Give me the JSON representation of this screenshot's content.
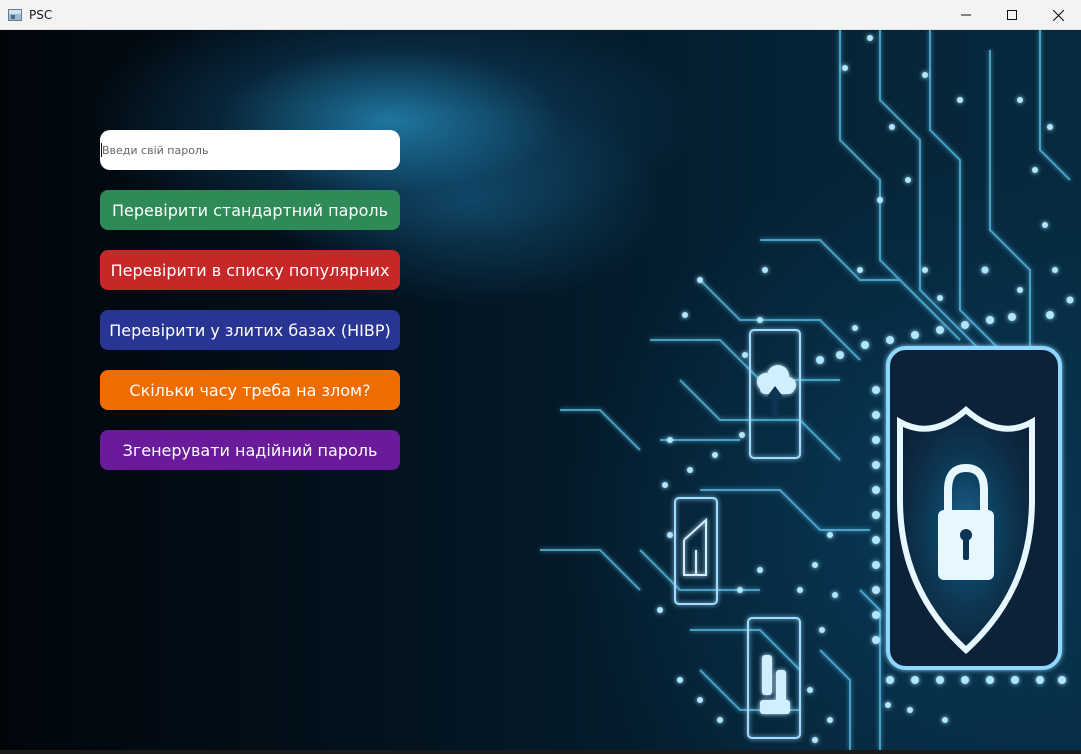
{
  "window": {
    "title": "PSC",
    "icon": "app-window-icon",
    "controls": [
      "minimize-icon",
      "maximize-icon",
      "close-icon"
    ]
  },
  "form": {
    "password_placeholder": "Введи свій пароль",
    "password_value": ""
  },
  "buttons": [
    {
      "label": "Перевірити стандартний пароль",
      "color": "#2e8b57"
    },
    {
      "label": "Перевірити в списку популярних",
      "color": "#c62828"
    },
    {
      "label": "Перевірити у злитих базах (HIBP)",
      "color": "#283593"
    },
    {
      "label": "Скільки часу треба на злом?",
      "color": "#ef6c00"
    },
    {
      "label": "Згенерувати надійний пароль",
      "color": "#6a1b9a"
    }
  ],
  "background": {
    "illustration": [
      "shield-lock-icon",
      "cloud-upload-icon",
      "document-icon",
      "rocket-icon"
    ]
  }
}
